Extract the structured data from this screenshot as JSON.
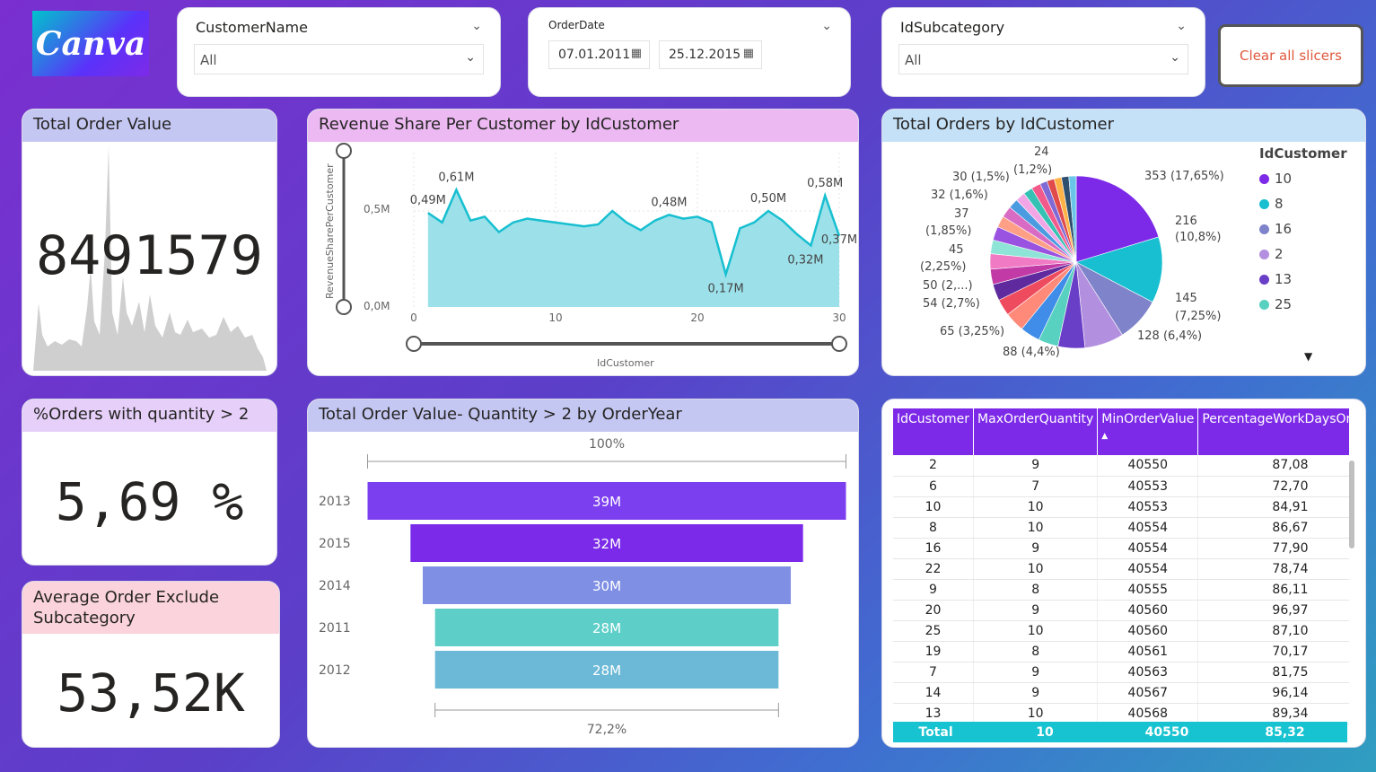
{
  "logo": {
    "text": "Canva"
  },
  "slicers": {
    "customer": {
      "label": "CustomerName",
      "value": "All"
    },
    "orderdate": {
      "label": "OrderDate",
      "from": "07.01.2011",
      "to": "25.12.2015"
    },
    "subcategory": {
      "label": "IdSubcategory",
      "value": "All"
    }
  },
  "clear_button": {
    "label": "Clear all slicers"
  },
  "kpi_total_order_value": {
    "title": "Total Order Value",
    "value": "8491579",
    "title_bg": "#c5c7f3"
  },
  "kpi_orders_qty": {
    "title": "%Orders with quantity > 2",
    "value": "5,69 %",
    "title_bg": "#e6d0fa"
  },
  "kpi_avg_order": {
    "title": "Average Order Exclude Subcategory",
    "value": "53,52K",
    "title_bg": "#fbd3dc"
  },
  "revenue_chart": {
    "title": "Revenue Share Per Customer by IdCustomer",
    "title_bg": "#ecb9f3",
    "ylabel": "RevenueSharePerCustomer",
    "xlabel": "IdCustomer",
    "ytick_labels": [
      "0,0M",
      "0,5M"
    ],
    "xtick_labels": [
      "0",
      "10",
      "20",
      "30"
    ],
    "annotations": [
      "0,49M",
      "0,61M",
      "0,48M",
      "0,50M",
      "0,58M",
      "0,17M",
      "0,32M",
      "0,37M"
    ]
  },
  "pie_chart": {
    "title": "Total Orders by IdCustomer",
    "title_bg": "#c5e1f8",
    "legend_title": "IdCustomer",
    "legend": [
      {
        "label": "10",
        "color": "#7d2ae8"
      },
      {
        "label": "8",
        "color": "#17bfd0"
      },
      {
        "label": "16",
        "color": "#7f83c9"
      },
      {
        "label": "2",
        "color": "#b38fdf"
      },
      {
        "label": "13",
        "color": "#6a3fc7"
      },
      {
        "label": "25",
        "color": "#58d1c1"
      }
    ],
    "slice_labels": [
      "353 (17,65%)",
      "216",
      "(10,8%)",
      "145",
      "(7,25%)",
      "128 (6,4%)",
      "88 (4,4%)",
      "65 (3,25%)",
      "54 (2,7%)",
      "50 (2,...)",
      "45",
      "(2,25%)",
      "37",
      "(1,85%)",
      "32 (1,6%)",
      "30 (1,5%)",
      "24",
      "(1,2%)"
    ]
  },
  "funnel_chart": {
    "title": "Total Order Value- Quantity > 2 by OrderYear",
    "title_bg": "#c5c7f3",
    "top_label": "100%",
    "bottom_label": "72,2%"
  },
  "table": {
    "headers": [
      "IdCustomer",
      "MaxOrderQuantity",
      "MinOrderValue",
      "PercentageWorkDaysOrders"
    ],
    "rows": [
      [
        "2",
        "9",
        "40550",
        "87,08"
      ],
      [
        "6",
        "7",
        "40553",
        "72,70"
      ],
      [
        "10",
        "10",
        "40553",
        "84,91"
      ],
      [
        "8",
        "10",
        "40554",
        "86,67"
      ],
      [
        "16",
        "9",
        "40554",
        "77,90"
      ],
      [
        "22",
        "10",
        "40554",
        "78,74"
      ],
      [
        "9",
        "8",
        "40555",
        "86,11"
      ],
      [
        "20",
        "9",
        "40560",
        "96,97"
      ],
      [
        "25",
        "10",
        "40560",
        "87,10"
      ],
      [
        "19",
        "8",
        "40561",
        "70,17"
      ],
      [
        "7",
        "9",
        "40563",
        "81,75"
      ],
      [
        "14",
        "9",
        "40567",
        "96,14"
      ],
      [
        "13",
        "10",
        "40568",
        "89,34"
      ]
    ],
    "total": [
      "Total",
      "10",
      "40550",
      "85,32"
    ]
  },
  "chart_data": [
    {
      "type": "area",
      "title": "Revenue Share Per Customer by IdCustomer",
      "xlabel": "IdCustomer",
      "ylabel": "RevenueSharePerCustomer",
      "xlim": [
        0,
        30
      ],
      "ylim": [
        0,
        0.65
      ],
      "x": [
        1,
        2,
        3,
        4,
        5,
        6,
        7,
        8,
        9,
        10,
        11,
        12,
        13,
        14,
        15,
        16,
        17,
        18,
        19,
        20,
        21,
        22,
        23,
        24,
        25,
        26,
        27,
        28,
        29,
        30
      ],
      "values": [
        0.49,
        0.44,
        0.61,
        0.45,
        0.47,
        0.39,
        0.44,
        0.46,
        0.45,
        0.44,
        0.43,
        0.42,
        0.43,
        0.5,
        0.44,
        0.4,
        0.45,
        0.48,
        0.46,
        0.47,
        0.44,
        0.17,
        0.41,
        0.44,
        0.5,
        0.45,
        0.38,
        0.32,
        0.58,
        0.37
      ],
      "annotations": [
        {
          "x": 1,
          "y": 0.49,
          "text": "0,49M"
        },
        {
          "x": 3,
          "y": 0.61,
          "text": "0,61M"
        },
        {
          "x": 18,
          "y": 0.48,
          "text": "0,48M"
        },
        {
          "x": 25,
          "y": 0.5,
          "text": "0,50M"
        },
        {
          "x": 29,
          "y": 0.58,
          "text": "0,58M"
        },
        {
          "x": 22,
          "y": 0.17,
          "text": "0,17M"
        },
        {
          "x": 28,
          "y": 0.32,
          "text": "0,32M"
        },
        {
          "x": 30,
          "y": 0.37,
          "text": "0,37M"
        }
      ]
    },
    {
      "type": "pie",
      "title": "Total Orders by IdCustomer",
      "legend_title": "IdCustomer",
      "slices": [
        {
          "label": "10",
          "value": 353,
          "pct": 17.65,
          "color": "#7d2ae8"
        },
        {
          "label": "8",
          "value": 216,
          "pct": 10.8,
          "color": "#17bfd0"
        },
        {
          "label": "16",
          "value": 145,
          "pct": 7.25,
          "color": "#7f83c9"
        },
        {
          "label": "2",
          "value": 128,
          "pct": 6.4,
          "color": "#b38fdf"
        },
        {
          "label": "13",
          "value": 88,
          "pct": 4.4,
          "color": "#6a3fc7"
        },
        {
          "label": "25",
          "value": 65,
          "pct": 3.25,
          "color": "#58d1c1"
        },
        {
          "label": "",
          "value": 65,
          "pct": 3.25,
          "color": "#3f8de8"
        },
        {
          "label": "",
          "value": 65,
          "pct": 3.25,
          "color": "#ff8a7a"
        },
        {
          "label": "",
          "value": 54,
          "pct": 2.7,
          "color": "#ef4b5f"
        },
        {
          "label": "",
          "value": 54,
          "pct": 2.7,
          "color": "#5e2a9e"
        },
        {
          "label": "",
          "value": 50,
          "pct": 2.5,
          "color": "#c23aa5"
        },
        {
          "label": "",
          "value": 50,
          "pct": 2.5,
          "color": "#f07ac4"
        },
        {
          "label": "",
          "value": 45,
          "pct": 2.25,
          "color": "#8ee4d6"
        },
        {
          "label": "",
          "value": 45,
          "pct": 2.25,
          "color": "#9a52e0"
        },
        {
          "label": "",
          "value": 37,
          "pct": 1.85,
          "color": "#ff9f85"
        },
        {
          "label": "",
          "value": 37,
          "pct": 1.85,
          "color": "#d86bc4"
        },
        {
          "label": "",
          "value": 32,
          "pct": 1.6,
          "color": "#4b9be0"
        },
        {
          "label": "",
          "value": 32,
          "pct": 1.6,
          "color": "#f2a6e6"
        },
        {
          "label": "",
          "value": 30,
          "pct": 1.5,
          "color": "#35c2b4"
        },
        {
          "label": "",
          "value": 30,
          "pct": 1.5,
          "color": "#f25a8c"
        },
        {
          "label": "",
          "value": 24,
          "pct": 1.2,
          "color": "#7f6ad6"
        },
        {
          "label": "",
          "value": 24,
          "pct": 1.2,
          "color": "#e04a4a"
        },
        {
          "label": "",
          "value": 24,
          "pct": 1.2,
          "color": "#ffb347"
        },
        {
          "label": "",
          "value": 24,
          "pct": 1.2,
          "color": "#2f4f6f"
        },
        {
          "label": "",
          "value": 24,
          "pct": 1.2,
          "color": "#6ac6e8"
        }
      ]
    },
    {
      "type": "bar",
      "title": "Total Order Value- Quantity > 2 by OrderYear",
      "categories": [
        "2013",
        "2015",
        "2014",
        "2011",
        "2012"
      ],
      "values": [
        39,
        32,
        30,
        28,
        28
      ],
      "value_labels": [
        "39M",
        "32M",
        "30M",
        "28M",
        "28M"
      ],
      "colors": [
        "#7c3ff0",
        "#7a2ae8",
        "#7f90e4",
        "#5ecfc8",
        "#6bb9d6"
      ],
      "top_label": "100%",
      "bottom_label": "72,2%"
    }
  ]
}
